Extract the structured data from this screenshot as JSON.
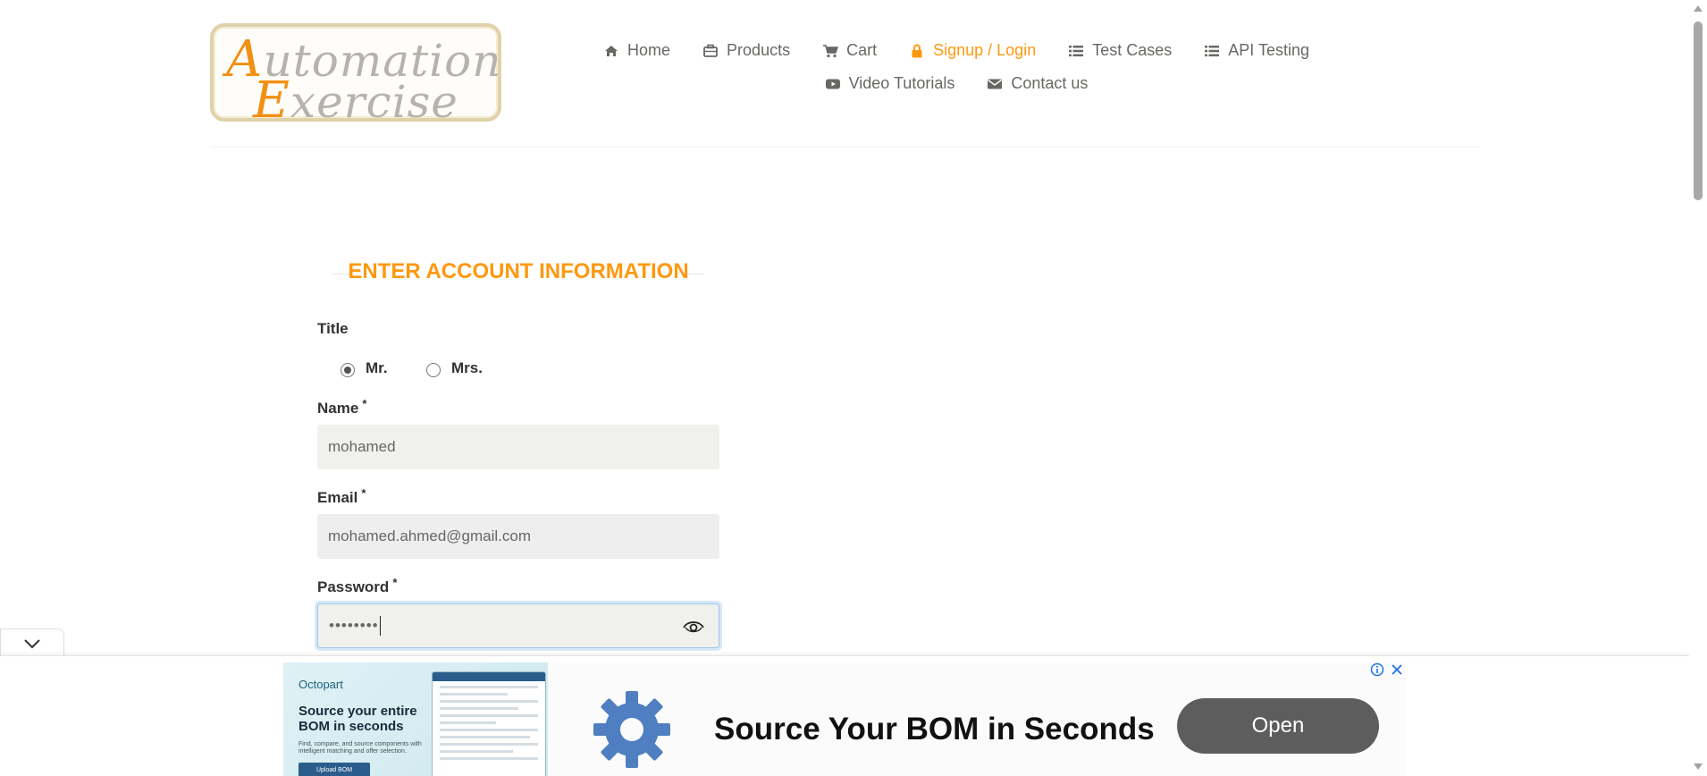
{
  "logo": {
    "line1_cap": "A",
    "line1_rest": "utomation",
    "line2_cap": "E",
    "line2_rest": "xercise"
  },
  "nav": {
    "row1": [
      {
        "label": "Home",
        "icon": "home-icon"
      },
      {
        "label": "Products",
        "icon": "products-icon"
      },
      {
        "label": "Cart",
        "icon": "cart-icon"
      },
      {
        "label": "Signup / Login",
        "icon": "lock-icon",
        "active": true
      },
      {
        "label": "Test Cases",
        "icon": "list-icon"
      },
      {
        "label": "API Testing",
        "icon": "list-icon"
      }
    ],
    "row2": [
      {
        "label": "Video Tutorials",
        "icon": "youtube-icon"
      },
      {
        "label": "Contact us",
        "icon": "envelope-icon"
      }
    ]
  },
  "form": {
    "heading": "ENTER ACCOUNT INFORMATION",
    "title_label": "Title",
    "title_options": [
      "Mr.",
      "Mrs."
    ],
    "title_selected": "Mr.",
    "name_label": "Name",
    "name_value": "mohamed",
    "email_label": "Email",
    "email_value": "mohamed.ahmed@gmail.com",
    "password_label": "Password",
    "password_value": "••••••••",
    "required_mark": "*"
  },
  "ad": {
    "brand": "Octopart",
    "headline": "Source your entire BOM in seconds",
    "subtext": "Find, compare, and source components with intelligent matching and offer selection.",
    "small_cta": "Upload BOM",
    "title": "Source Your BOM in Seconds",
    "button": "Open"
  },
  "colors": {
    "accent": "#fe980f",
    "text": "#696763",
    "input_bg": "#f0f0ec"
  }
}
